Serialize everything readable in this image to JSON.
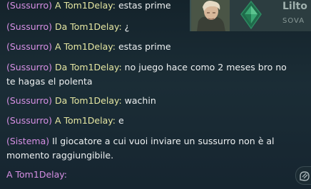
{
  "messages": [
    {
      "prefix": "(Sussurro)",
      "sender": "A Tom1Delay:",
      "text": "estas prime"
    },
    {
      "prefix": "(Sussurro)",
      "sender": "Da Tom1Delay:",
      "text": "¿"
    },
    {
      "prefix": "(Sussurro)",
      "sender": "A Tom1Delay:",
      "text": "estas prime"
    },
    {
      "prefix": "(Sussurro)",
      "sender": "Da Tom1Delay:",
      "text": "no juego hace como 2 meses bro no te hagas el polenta"
    },
    {
      "prefix": "(Sussurro)",
      "sender": "Da Tom1Delay:",
      "text": "wachin"
    },
    {
      "prefix": "(Sussurro)",
      "sender": "A Tom1Delay:",
      "text": "e"
    },
    {
      "prefix": "(Sistema)",
      "sender": "",
      "text": "Il giocatore a cui vuoi inviare un sussurro non è al momento raggiungibile."
    }
  ],
  "input": {
    "prefix": "A Tom1Delay:",
    "value": ""
  },
  "player_card": {
    "name": "Lilto",
    "role": "SOVA"
  },
  "icons": {
    "rank": "emerald-rank-icon",
    "toggle": "chat-toggle-icon"
  },
  "colors": {
    "whisper_prefix": "#d68fe4",
    "sender": "#e6e7a2",
    "text": "#eef1f2",
    "background": "#1b2d36"
  }
}
